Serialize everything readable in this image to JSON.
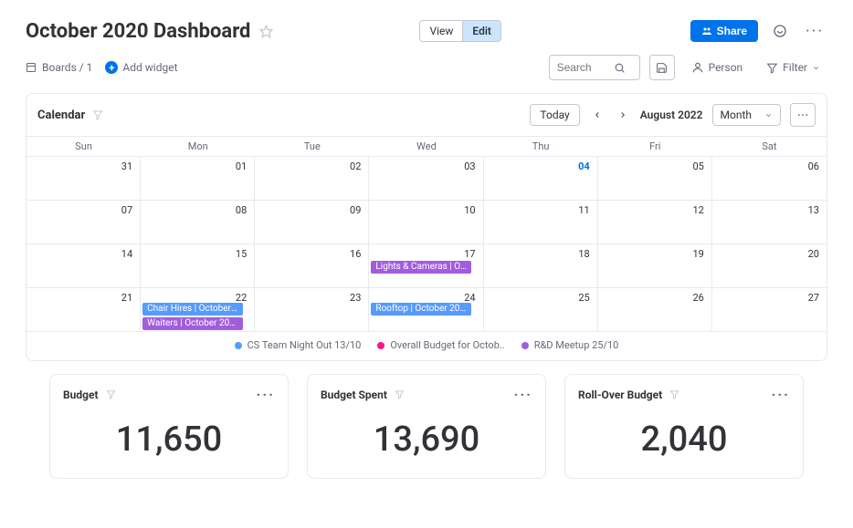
{
  "header": {
    "title": "October 2020 Dashboard",
    "view_label": "View",
    "edit_label": "Edit",
    "share_label": "Share"
  },
  "subbar": {
    "breadcrumb": "Boards / 1",
    "add_widget": "Add widget",
    "search_placeholder": "Search",
    "person_label": "Person",
    "filter_label": "Filter"
  },
  "calendar": {
    "title": "Calendar",
    "today_label": "Today",
    "current_label": "August 2022",
    "view_mode": "Month",
    "days": [
      "Sun",
      "Mon",
      "Tue",
      "Wed",
      "Thu",
      "Fri",
      "Sat"
    ],
    "weeks": [
      [
        {
          "n": "31"
        },
        {
          "n": "01"
        },
        {
          "n": "02"
        },
        {
          "n": "03"
        },
        {
          "n": "04",
          "today": true
        },
        {
          "n": "05"
        },
        {
          "n": "06"
        }
      ],
      [
        {
          "n": "07"
        },
        {
          "n": "08"
        },
        {
          "n": "09"
        },
        {
          "n": "10"
        },
        {
          "n": "11"
        },
        {
          "n": "12"
        },
        {
          "n": "13"
        }
      ],
      [
        {
          "n": "14"
        },
        {
          "n": "15"
        },
        {
          "n": "16"
        },
        {
          "n": "17"
        },
        {
          "n": "18"
        },
        {
          "n": "19"
        },
        {
          "n": "20"
        }
      ],
      [
        {
          "n": "21"
        },
        {
          "n": "22"
        },
        {
          "n": "23"
        },
        {
          "n": "24"
        },
        {
          "n": "25"
        },
        {
          "n": "26"
        },
        {
          "n": "27"
        }
      ]
    ],
    "events": {
      "lights": "Lights & Cameras | Oc..",
      "chair": "Chair Hires | October 2..",
      "waiters": "Waiters | October 202..",
      "rooftop": "Rooftop | October 202.."
    },
    "legend": [
      {
        "color": "#579bfc",
        "label": "CS Team Night Out 13/10"
      },
      {
        "color": "#ff158a",
        "label": "Overall Budget for Octob.."
      },
      {
        "color": "#a25ddc",
        "label": "R&D Meetup 25/10"
      }
    ]
  },
  "stats": [
    {
      "title": "Budget",
      "value": "11,650"
    },
    {
      "title": "Budget Spent",
      "value": "13,690"
    },
    {
      "title": "Roll-Over Budget",
      "value": "2,040"
    }
  ]
}
